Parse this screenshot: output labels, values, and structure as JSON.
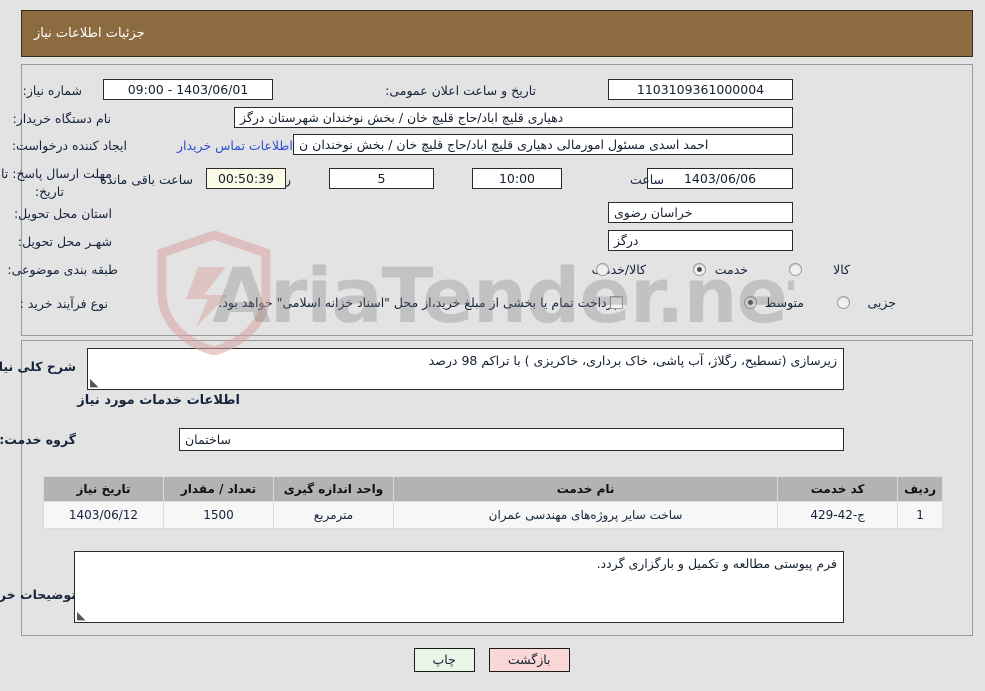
{
  "header": {
    "title": "جزئیات اطلاعات نیاز"
  },
  "watermark": {
    "text": "AriaTender.net",
    "shield_color": "#d9a3a3"
  },
  "colors": {
    "header_bar": "#8d6b40",
    "link": "#2a4fd0",
    "table_header": "#b3b3b3",
    "timer_background": "#fbfbe8",
    "print_button": "#e9f7e9",
    "back_button": "#fad8d8"
  },
  "top_section": {
    "need_number_label": "شماره نیاز:",
    "need_number_value": "1103109361000004",
    "announce_datetime_label": "تاریخ و ساعت اعلان عمومی:",
    "announce_datetime_value": "1403/06/01 - 09:00",
    "buyer_org_label": "نام دستگاه خریدار:",
    "buyer_org_value": "دهیاری قلیچ اباد/حاج قلیچ خان / بخش نوخندان شهرستان درگز",
    "request_creator_label": "ایجاد کننده درخواست:",
    "request_creator_value": "احمد اسدی مسئول امورمالی دهیاری قلیچ اباد/حاج قلیچ خان / بخش نوخندان ن",
    "buyer_contact_link": "اطلاعات تماس خریدار",
    "deadline_label": "مهلت ارسال پاسخ: تا تاریخ:",
    "deadline_date": "1403/06/06",
    "deadline_hour_label": "ساعت",
    "deadline_hour_value": "10:00",
    "remaining_days_value": "5",
    "remaining_days_label": "روز و",
    "remaining_timer_value": "00:50:39",
    "remaining_timer_label": "ساعت باقی مانده",
    "province_label": "استان محل تحویل:",
    "province_value": "خراسان رضوی",
    "city_label": "شهـر محل تحویل:",
    "city_value": "درگز",
    "category_label": "طبقه بندی موضوعی:",
    "category_options": [
      {
        "label": "کالا",
        "selected": false
      },
      {
        "label": "خدمت",
        "selected": true
      },
      {
        "label": "کالا/خدمت",
        "selected": false
      }
    ],
    "process_label": "نوع فرآیند خرید :",
    "process_options": [
      {
        "label": "جزیی",
        "selected": false
      },
      {
        "label": "متوسط",
        "selected": true
      }
    ],
    "treasury_checkbox_checked": false,
    "treasury_note": "پرداخت تمام یا بخشی از مبلغ خرید،از محل \"اسناد خزانه اسلامی\" خواهد بود."
  },
  "bottom_section": {
    "general_desc_label": "شرح کلی نیاز:",
    "general_desc_value": "زیرسازی (تسطیح، رگلاژ، آب پاشی، خاک برداری، خاکریزی ) با تراکم 98 درصد",
    "services_heading": "اطلاعات خدمات مورد نیاز",
    "service_group_label": "گروه خدمت:",
    "service_group_value": "ساختمان",
    "table": {
      "headers": [
        "ردیف",
        "کد خدمت",
        "نام خدمت",
        "واحد اندازه گیری",
        "تعداد / مقدار",
        "تاریخ نیاز"
      ],
      "rows": [
        {
          "row": "1",
          "code": "ج-42-429",
          "name": "ساخت سایر پروژه‌های مهندسی عمران",
          "unit": "مترمربع",
          "quantity": "1500",
          "date": "1403/06/12"
        }
      ]
    },
    "buyer_notes_label": "توضیحات خریدار:",
    "buyer_notes_value": "فرم پیوستی مطالعه و تکمیل و بارگزاری گردد."
  },
  "footer": {
    "print_label": "چاپ",
    "back_label": "بازگشت"
  }
}
